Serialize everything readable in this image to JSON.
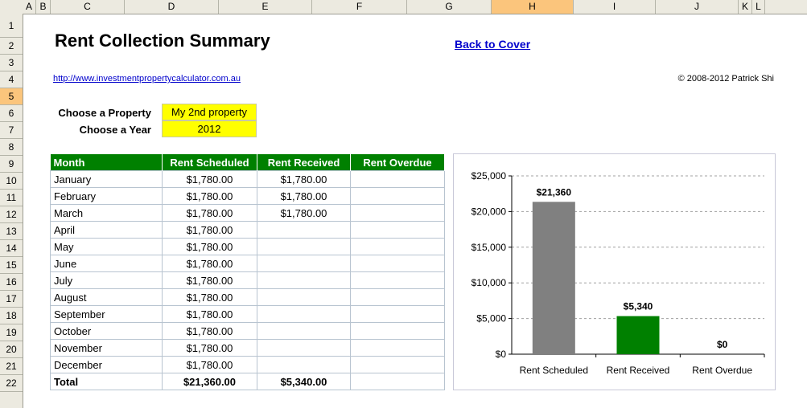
{
  "sheet": {
    "columns": [
      "A",
      "B",
      "C",
      "D",
      "E",
      "F",
      "G",
      "H",
      "I",
      "J",
      "K",
      "L"
    ],
    "selected_column": "H",
    "rows": [
      "1",
      "2",
      "3",
      "4",
      "5",
      "6",
      "7",
      "8",
      "9",
      "10",
      "11",
      "12",
      "13",
      "14",
      "15",
      "16",
      "17",
      "18",
      "19",
      "20",
      "21",
      "22"
    ],
    "selected_row": "5"
  },
  "header": {
    "title": "Rent Collection Summary",
    "back_link": "Back to Cover",
    "url": "http://www.investmentpropertycalculator.com.au",
    "copyright": "© 2008-2012 Patrick Shi"
  },
  "selectors": {
    "property_label": "Choose a Property",
    "property_value": "My 2nd property",
    "year_label": "Choose a Year",
    "year_value": "2012"
  },
  "table": {
    "headers": [
      "Month",
      "Rent Scheduled",
      "Rent Received",
      "Rent Overdue"
    ],
    "rows": [
      [
        "January",
        "$1,780.00",
        "$1,780.00",
        ""
      ],
      [
        "February",
        "$1,780.00",
        "$1,780.00",
        ""
      ],
      [
        "March",
        "$1,780.00",
        "$1,780.00",
        ""
      ],
      [
        "April",
        "$1,780.00",
        "",
        ""
      ],
      [
        "May",
        "$1,780.00",
        "",
        ""
      ],
      [
        "June",
        "$1,780.00",
        "",
        ""
      ],
      [
        "July",
        "$1,780.00",
        "",
        ""
      ],
      [
        "August",
        "$1,780.00",
        "",
        ""
      ],
      [
        "September",
        "$1,780.00",
        "",
        ""
      ],
      [
        "October",
        "$1,780.00",
        "",
        ""
      ],
      [
        "November",
        "$1,780.00",
        "",
        ""
      ],
      [
        "December",
        "$1,780.00",
        "",
        ""
      ]
    ],
    "total": [
      "Total",
      "$21,360.00",
      "$5,340.00",
      ""
    ]
  },
  "chart_data": {
    "type": "bar",
    "categories": [
      "Rent Scheduled",
      "Rent Received",
      "Rent Overdue"
    ],
    "values": [
      21360,
      5340,
      0
    ],
    "data_labels": [
      "$21,360",
      "$5,340",
      "$0"
    ],
    "colors": [
      "#808080",
      "#008000",
      "#808080"
    ],
    "ylim": [
      0,
      25000
    ],
    "yticks": [
      0,
      5000,
      10000,
      15000,
      20000,
      25000
    ],
    "ytick_labels": [
      "$0",
      "$5,000",
      "$10,000",
      "$15,000",
      "$20,000",
      "$25,000"
    ],
    "grid": true,
    "legend": "none"
  }
}
